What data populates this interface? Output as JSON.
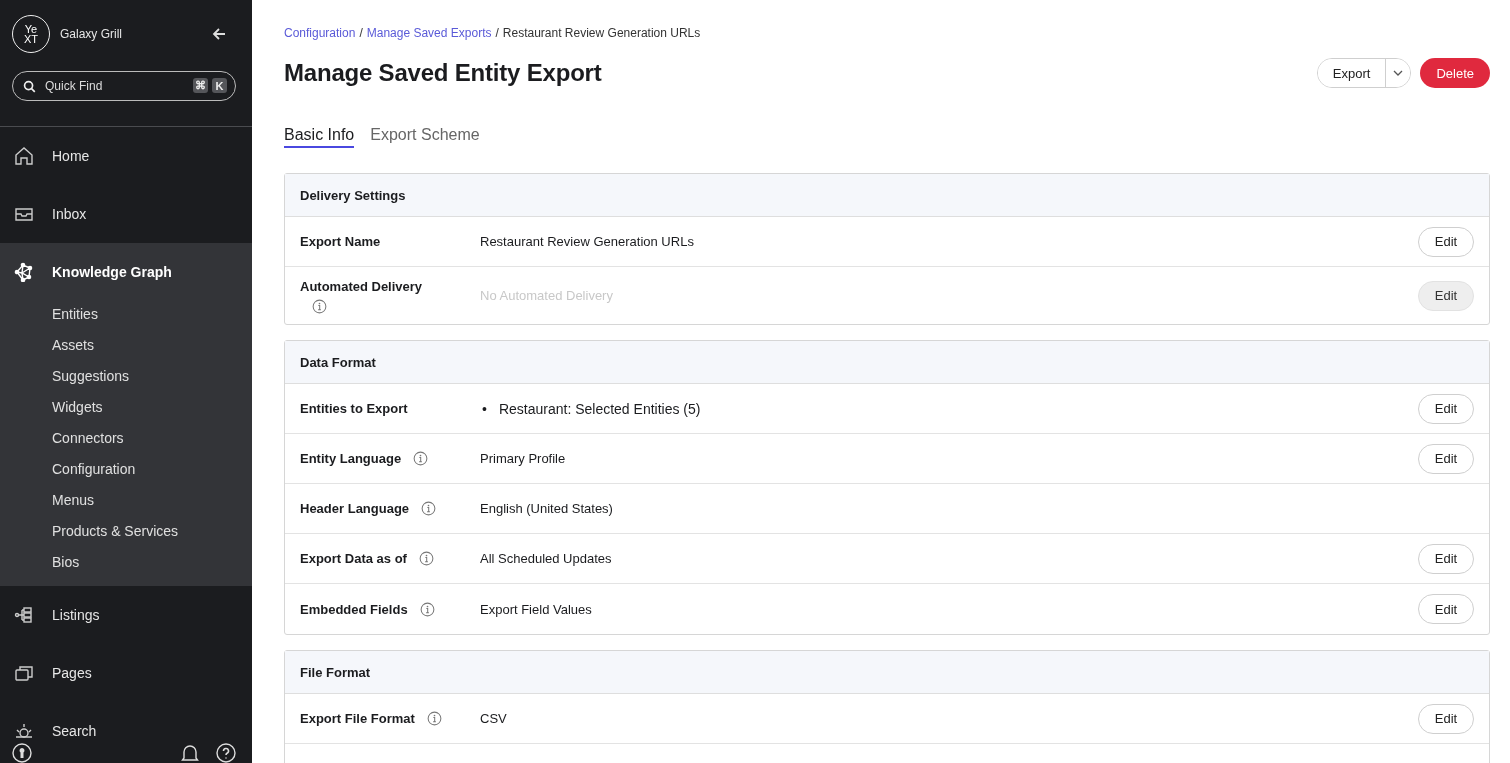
{
  "sidebar": {
    "logo": [
      "Ye",
      "XT"
    ],
    "org_name": "Galaxy Grill",
    "search": {
      "placeholder": "Quick Find",
      "shortcut": [
        "⌘",
        "K"
      ]
    },
    "items": [
      {
        "label": "Home",
        "selected": false,
        "expanded": false
      },
      {
        "label": "Inbox",
        "selected": false,
        "expanded": false
      },
      {
        "label": "Knowledge Graph",
        "selected": true,
        "expanded": true,
        "children": [
          {
            "label": "Entities"
          },
          {
            "label": "Assets"
          },
          {
            "label": "Suggestions"
          },
          {
            "label": "Widgets"
          },
          {
            "label": "Connectors"
          },
          {
            "label": "Configuration"
          },
          {
            "label": "Menus"
          },
          {
            "label": "Products & Services"
          },
          {
            "label": "Bios"
          }
        ]
      },
      {
        "label": "Listings",
        "selected": false,
        "expanded": false
      },
      {
        "label": "Pages",
        "selected": false,
        "expanded": false
      },
      {
        "label": "Search",
        "selected": false,
        "expanded": false
      }
    ]
  },
  "breadcrumb": [
    {
      "label": "Configuration",
      "link": true
    },
    {
      "label": "Manage Saved Exports",
      "link": true
    },
    {
      "label": "Restaurant Review Generation URLs",
      "link": false
    }
  ],
  "separator": "/",
  "title": "Manage Saved Entity Export",
  "actions": {
    "export": "Export",
    "delete": "Delete"
  },
  "tabs": [
    {
      "label": "Basic Info",
      "selected": true
    },
    {
      "label": "Export Scheme",
      "selected": false
    }
  ],
  "sections": [
    {
      "title": "Delivery Settings",
      "rows": [
        {
          "label": "Export Name",
          "kind": "text",
          "value": "Restaurant Review Generation URLs",
          "muted": false,
          "edit": {
            "label": "Edit",
            "disabled": false
          }
        },
        {
          "label": "Automated Delivery",
          "info": true,
          "info_below": true,
          "kind": "text",
          "value": "No Automated Delivery",
          "muted": true,
          "edit": {
            "label": "Edit",
            "disabled": true
          }
        }
      ]
    },
    {
      "title": "Data Format",
      "rows": [
        {
          "label": "Entities to Export",
          "kind": "bullets",
          "bullet": "•",
          "items": [
            "Restaurant: Selected Entities (5)"
          ],
          "edit": {
            "label": "Edit",
            "disabled": false
          }
        },
        {
          "label": "Entity Language",
          "info": true,
          "kind": "text",
          "value": "Primary Profile",
          "muted": false,
          "edit": {
            "label": "Edit",
            "disabled": false
          }
        },
        {
          "label": "Header Language",
          "info": true,
          "kind": "text",
          "value": "English (United States)",
          "muted": false
        },
        {
          "label": "Export Data as of",
          "info": true,
          "kind": "text",
          "value": "All Scheduled Updates",
          "muted": false,
          "edit": {
            "label": "Edit",
            "disabled": false
          }
        },
        {
          "label": "Embedded Fields",
          "info": true,
          "kind": "text",
          "value": "Export Field Values",
          "muted": false,
          "edit": {
            "label": "Edit",
            "disabled": false
          }
        }
      ]
    },
    {
      "title": "File Format",
      "rows": [
        {
          "label": "Export File Format",
          "info": true,
          "kind": "text",
          "value": "CSV",
          "muted": false,
          "edit": {
            "label": "Edit",
            "disabled": false
          }
        },
        {
          "kind": "empty"
        }
      ]
    }
  ]
}
